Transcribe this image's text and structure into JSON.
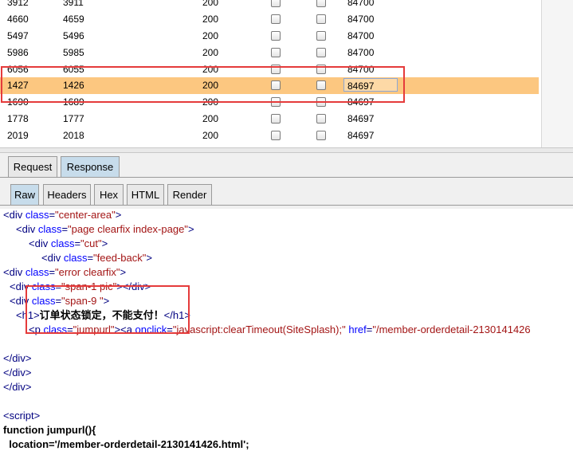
{
  "table": {
    "rows": [
      {
        "c0": "3912",
        "c1": "3911",
        "c2": "200",
        "c5": "84700"
      },
      {
        "c0": "4660",
        "c1": "4659",
        "c2": "200",
        "c5": "84700"
      },
      {
        "c0": "5497",
        "c1": "5496",
        "c2": "200",
        "c5": "84700"
      },
      {
        "c0": "5986",
        "c1": "5985",
        "c2": "200",
        "c5": "84700"
      },
      {
        "c0": "6056",
        "c1": "6055",
        "c2": "200",
        "c5": "84700"
      },
      {
        "c0": "1427",
        "c1": "1426",
        "c2": "200",
        "c5": "84697",
        "selected": true
      },
      {
        "c0": "1690",
        "c1": "1689",
        "c2": "200",
        "c5": "84697"
      },
      {
        "c0": "1778",
        "c1": "1777",
        "c2": "200",
        "c5": "84697"
      },
      {
        "c0": "2019",
        "c1": "2018",
        "c2": "200",
        "c5": "84697"
      }
    ]
  },
  "tabs": {
    "request": "Request",
    "response": "Response"
  },
  "subtabs": {
    "raw": "Raw",
    "headers": "Headers",
    "hex": "Hex",
    "html": "HTML",
    "render": "Render"
  },
  "code": {
    "l1": {
      "o": "<div ",
      "a": "class",
      "e": "=",
      "v": "\"center-area\"",
      "c": ">"
    },
    "l2": {
      "o": "<div ",
      "a": "class",
      "e": "=",
      "v": "\"page clearfix index-page\"",
      "c": ">"
    },
    "l3": {
      "o": "<div ",
      "a": "class",
      "e": "=",
      "v": "\"cut\"",
      "c": ">"
    },
    "l4": {
      "o": "<div ",
      "a": "class",
      "e": "=",
      "v": "\"feed-back\"",
      "c": ">"
    },
    "l5": {
      "o": "<div ",
      "a": "class",
      "e": "=",
      "v": "\"error clearfix\"",
      "c": ">"
    },
    "l6": {
      "o": "<div ",
      "a": "class",
      "e": "=",
      "v": "\"span-1 pic\"",
      "c": "></div>"
    },
    "l7": {
      "o": "<div ",
      "a": "class",
      "e": "=",
      "v": "\"span-9 \"",
      "c": ">"
    },
    "l8": {
      "o": "<h1>",
      "t": "订单状态锁定，不能支付！",
      "c": "</h1>"
    },
    "l9": {
      "o": "<p ",
      "a": "class",
      "e": "=",
      "v": "\"jumpurl\"",
      "m": "><a ",
      "a2": "onclick",
      "e2": "=",
      "v2": "\"javascript:clearTimeout(SiteSplash);\"",
      "sp": " ",
      "a3": "href",
      "e3": "=",
      "v3": "\"/member-orderdetail-2130141426"
    },
    "l10": "</div>",
    "l11": "</div>",
    "l12": "</div>",
    "l13": "<script>",
    "l14": "function jumpurl(){",
    "l15": {
      "k": "  location=",
      "s": "'/member-orderdetail-2130141426.html'",
      "e": ";"
    }
  }
}
